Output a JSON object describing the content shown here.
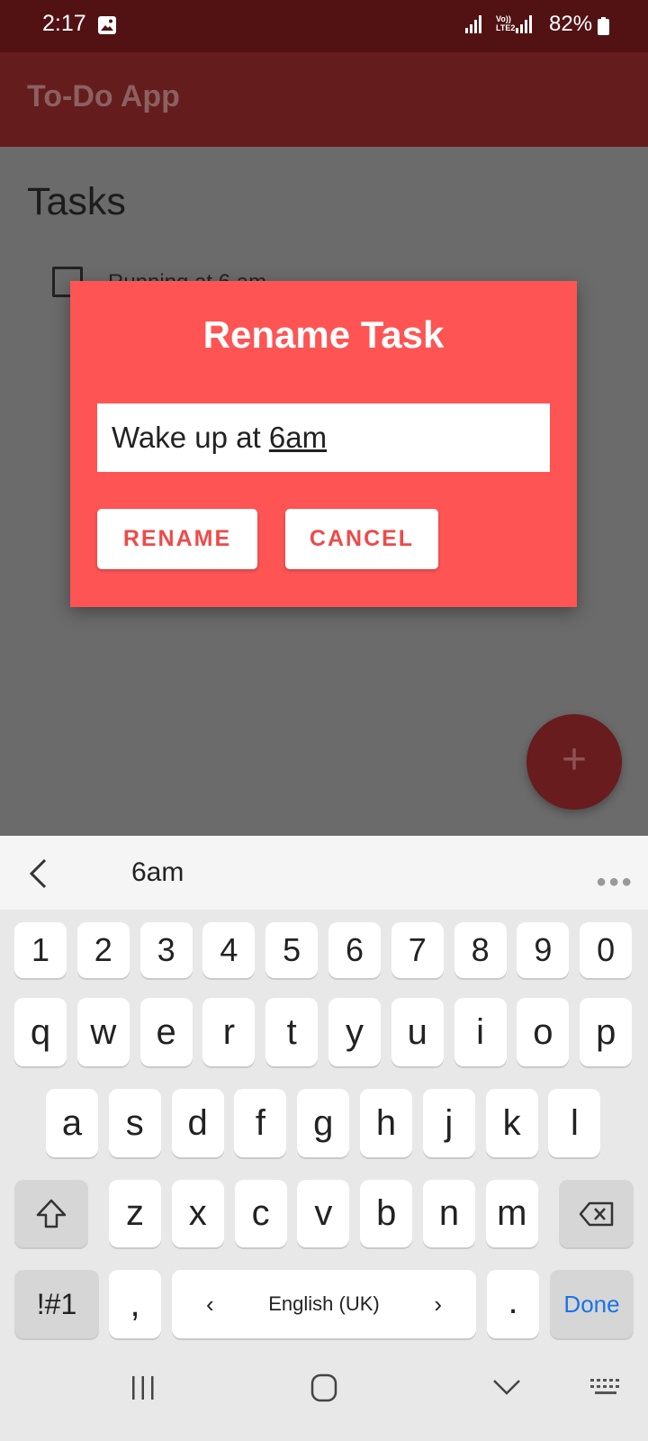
{
  "status_bar": {
    "time": "2:17",
    "network_label": "Vo)) LTE2",
    "battery": "82%"
  },
  "app_bar": {
    "title": "To-Do App"
  },
  "main": {
    "heading": "Tasks",
    "tasks": [
      {
        "label": "Running at 6 am",
        "checked": false
      }
    ]
  },
  "dialog": {
    "title": "Rename Task",
    "input_value_prefix": "Wake up at ",
    "input_value_composing": "6am",
    "rename_label": "RENAME",
    "cancel_label": "CANCEL"
  },
  "fab": {
    "label": "+"
  },
  "keyboard": {
    "suggestion": "6am",
    "number_row": [
      "1",
      "2",
      "3",
      "4",
      "5",
      "6",
      "7",
      "8",
      "9",
      "0"
    ],
    "row1": [
      "q",
      "w",
      "e",
      "r",
      "t",
      "y",
      "u",
      "i",
      "o",
      "p"
    ],
    "row2": [
      "a",
      "s",
      "d",
      "f",
      "g",
      "h",
      "j",
      "k",
      "l"
    ],
    "row3": [
      "z",
      "x",
      "c",
      "v",
      "b",
      "n",
      "m"
    ],
    "symbols_label": "!#1",
    "comma_label": ",",
    "language_label": "English (UK)",
    "period_label": ".",
    "done_label": "Done"
  },
  "colors": {
    "status_bar": "#521213",
    "app_bar": "#641c1d",
    "dialog": "#fe5454",
    "button_text": "#ee4a4a",
    "done_text": "#1a73e8"
  },
  "icons": [
    "image-icon",
    "signal-icon",
    "battery-icon",
    "back-chevron-icon",
    "more-icon",
    "shift-icon",
    "backspace-icon",
    "recents-icon",
    "home-icon",
    "nav-back-icon",
    "keyboard-icon"
  ]
}
